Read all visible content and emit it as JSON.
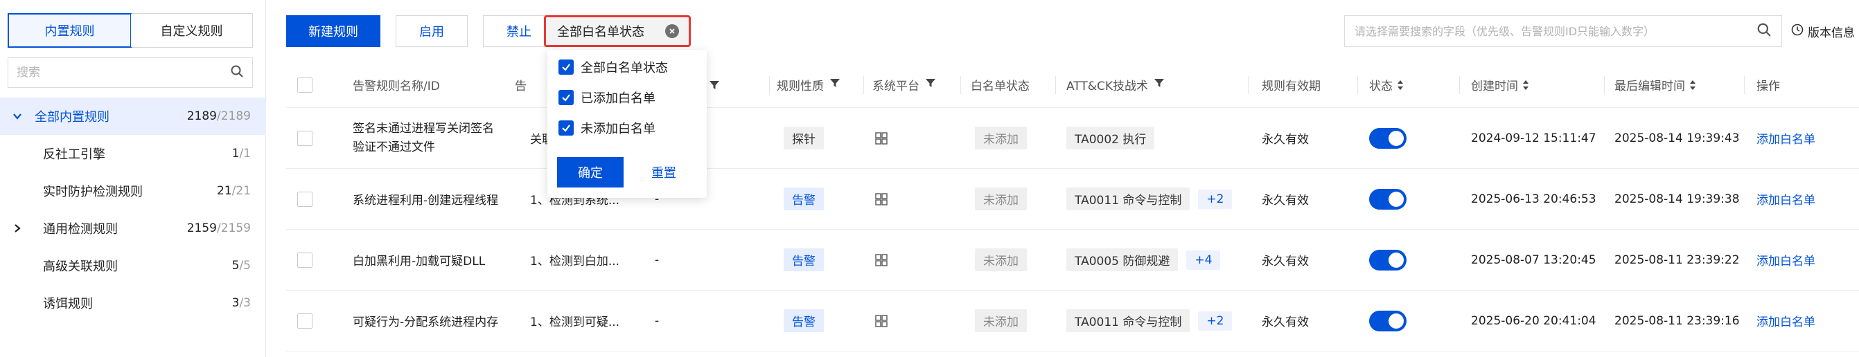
{
  "sidebar": {
    "tabs": [
      {
        "label": "内置规则",
        "active": true
      },
      {
        "label": "自定义规则",
        "active": false
      }
    ],
    "search_placeholder": "搜索",
    "tree": [
      {
        "name": "全部内置规则",
        "count": "2189",
        "total": "/2189",
        "expandable": true,
        "expanded": true,
        "selected": true,
        "indent": 0
      },
      {
        "name": "反社工引擎",
        "count": "1",
        "total": "/1",
        "expandable": false,
        "selected": false
      },
      {
        "name": "实时防护检测规则",
        "count": "21",
        "total": "/21",
        "expandable": false,
        "selected": false
      },
      {
        "name": "通用检测规则",
        "count": "2159",
        "total": "/2159",
        "expandable": true,
        "expanded": false,
        "selected": false
      },
      {
        "name": "高级关联规则",
        "count": "5",
        "total": "/5",
        "expandable": false,
        "selected": false
      },
      {
        "name": "诱饵规则",
        "count": "3",
        "total": "/3",
        "expandable": false,
        "selected": false
      }
    ]
  },
  "toolbar": {
    "new_rule": "新建规则",
    "enable": "启用",
    "disable": "禁止",
    "filter_chip": "全部白名单状态"
  },
  "search": {
    "placeholder": "请选择需要搜索的字段（优先级、告警规则ID只能输入数字）"
  },
  "version_label": "版本信息",
  "dropdown": {
    "options": [
      {
        "label": "全部白名单状态",
        "checked": true
      },
      {
        "label": "已添加白名单",
        "checked": true
      },
      {
        "label": "未添加白名单",
        "checked": true
      }
    ],
    "confirm": "确定",
    "reset": "重置"
  },
  "table": {
    "headers": {
      "name": "告警规则名称/ID",
      "desc": "告",
      "nature": "规则性质",
      "platform": "系统平台",
      "whitelist": "白名单状态",
      "attck": "ATT&CK技战术",
      "validity": "规则有效期",
      "status": "状态",
      "created": "创建时间",
      "edited": "最后编辑时间",
      "action": "操作"
    },
    "rows": [
      {
        "name_l1": "签名未通过进程写关闭签名",
        "name_l2": "验证不通过文件",
        "desc": "关联",
        "col3": "",
        "nature": "探针",
        "nature_style": "gray",
        "whitelist": "未添加",
        "attck": "TA0002 执行",
        "attck_more": "",
        "validity": "永久有效",
        "enabled": true,
        "created": "2024-09-12 15:11:47",
        "edited": "2025-08-14 19:39:43",
        "action": "添加白名单"
      },
      {
        "name_l1": "系统进程利用-创建远程线程",
        "name_l2": "",
        "desc": "1、检测到系统...",
        "col3": "-",
        "nature": "告警",
        "nature_style": "blue",
        "whitelist": "未添加",
        "attck": "TA0011 命令与控制",
        "attck_more": "+2",
        "validity": "永久有效",
        "enabled": true,
        "created": "2025-06-13 20:46:53",
        "edited": "2025-08-14 19:39:38",
        "action": "添加白名单"
      },
      {
        "name_l1": "白加黑利用-加载可疑DLL",
        "name_l2": "",
        "desc": "1、检测到白加...",
        "col3": "-",
        "nature": "告警",
        "nature_style": "blue",
        "whitelist": "未添加",
        "attck": "TA0005 防御规避",
        "attck_more": "+4",
        "validity": "永久有效",
        "enabled": true,
        "created": "2025-08-07 13:20:45",
        "edited": "2025-08-11 23:39:22",
        "action": "添加白名单"
      },
      {
        "name_l1": "可疑行为-分配系统进程内存",
        "name_l2": "",
        "desc": "1、检测到可疑...",
        "col3": "-",
        "nature": "告警",
        "nature_style": "blue",
        "whitelist": "未添加",
        "attck": "TA0011 命令与控制",
        "attck_more": "+2",
        "validity": "永久有效",
        "enabled": true,
        "created": "2025-06-20 20:41:04",
        "edited": "2025-08-11 23:39:16",
        "action": "添加白名单"
      }
    ]
  },
  "colors": {
    "primary": "#0052d9",
    "highlight_border": "#e53935"
  }
}
